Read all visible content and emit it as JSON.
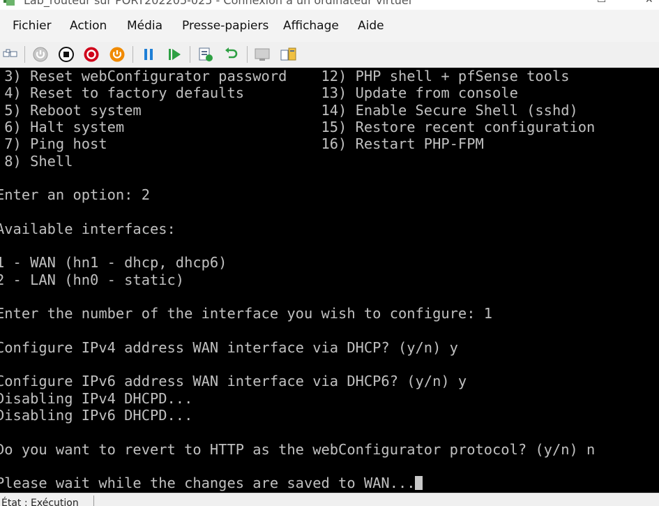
{
  "window": {
    "title": "Lab_routeur sur PORT202205-025 - Connexion à un ordinateur virtuel"
  },
  "menu": [
    "Fichier",
    "Action",
    "Média",
    "Presse-papiers",
    "Affichage",
    "Aide"
  ],
  "toolbar": {
    "buttons": [
      "ctrl-alt-del",
      "start",
      "turn-off",
      "shutdown",
      "save",
      "pause",
      "resume",
      "checkpoint",
      "revert",
      "enhanced-session",
      "share"
    ]
  },
  "console": {
    "lines": [
      " 3) Reset webConfigurator password    12) PHP shell + pfSense tools",
      " 4) Reset to factory defaults         13) Update from console",
      " 5) Reboot system                     14) Enable Secure Shell (sshd)",
      " 6) Halt system                       15) Restore recent configuration",
      " 7) Ping host                         16) Restart PHP-FPM",
      " 8) Shell",
      "",
      "Enter an option: 2",
      "",
      "Available interfaces:",
      "",
      "1 - WAN (hn1 - dhcp, dhcp6)",
      "2 - LAN (hn0 - static)",
      "",
      "Enter the number of the interface you wish to configure: 1",
      "",
      "Configure IPv4 address WAN interface via DHCP? (y/n) y",
      "",
      "Configure IPv6 address WAN interface via DHCP6? (y/n) y",
      "Disabling IPv4 DHCPD...",
      "Disabling IPv6 DHCPD...",
      "",
      "Do you want to revert to HTTP as the webConfigurator protocol? (y/n) n",
      "",
      "Please wait while the changes are saved to WAN..."
    ]
  },
  "status": {
    "text": "État : Exécution"
  }
}
